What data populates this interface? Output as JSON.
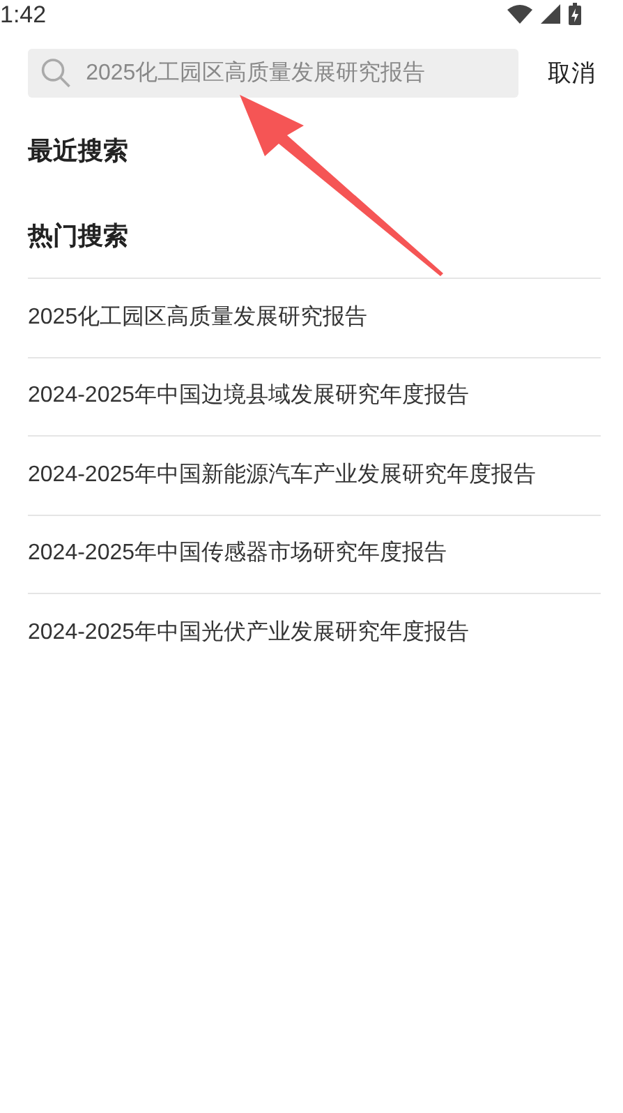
{
  "status_bar": {
    "time": "1:42"
  },
  "search": {
    "placeholder": "2025化工园区高质量发展研究报告",
    "cancel": "取消"
  },
  "recent": {
    "title": "最近搜索"
  },
  "hot": {
    "title": "热门搜索",
    "items": [
      "2025化工园区高质量发展研究报告",
      "2024-2025年中国边境县域发展研究年度报告",
      "2024-2025年中国新能源汽车产业发展研究年度报告",
      "2024-2025年中国传感器市场研究年度报告",
      "2024-2025年中国光伏产业发展研究年度报告"
    ]
  }
}
